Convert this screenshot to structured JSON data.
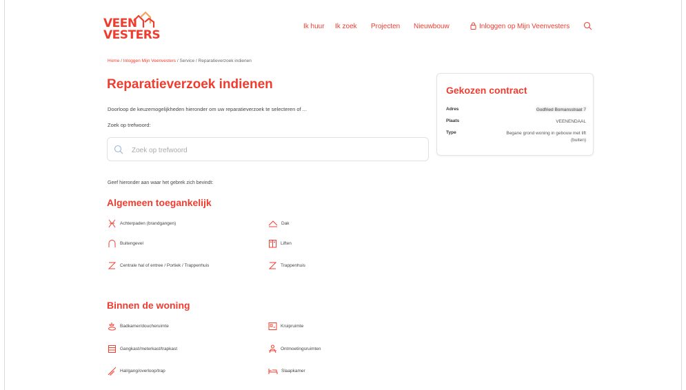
{
  "brand": {
    "logo_line1": "VEEN",
    "logo_line2": "VESTERS",
    "accent": "#f03c2f"
  },
  "nav": {
    "items": [
      "Ik huur",
      "Ik zoek",
      "Projecten",
      "Nieuwbouw"
    ],
    "login": "Inloggen op Mijn Veenvesters",
    "icons": {
      "login": "lock-icon",
      "search": "search-icon"
    }
  },
  "breadcrumb": {
    "home": "Home",
    "sep1": " / ",
    "login": "Inloggen Mijn Veenvesters",
    "sep2": " / ",
    "service": "Service",
    "sep3": " / ",
    "current": "Reparatieverzoek indienen"
  },
  "page": {
    "title": "Reparatieverzoek indienen",
    "intro": "Doorloop de keuzemogelijkheden hieronder om uw reparatieverzoek te selecteren of ...",
    "search_label": "Zoek op trefwoord:",
    "search_placeholder": "Zoek op trefwoord",
    "search_value": "",
    "location_question": "Geef hieronder aan waar het gebrek zich bevindt:"
  },
  "sections": [
    {
      "title": "Algemeen toegankelijk",
      "items": [
        {
          "label": "Achterpaden (brandgangen)",
          "icon": "path-icon"
        },
        {
          "label": "Dak",
          "icon": "roof-icon"
        },
        {
          "label": "Buitengevel",
          "icon": "facade-icon"
        },
        {
          "label": "Liften",
          "icon": "elevator-icon"
        },
        {
          "label": "Centrale hal of entree / Portiek / Trappenhuis",
          "icon": "stairs-icon"
        },
        {
          "label": "Trappenhuis",
          "icon": "stairs-icon"
        }
      ]
    },
    {
      "title": "Binnen de woning",
      "items": [
        {
          "label": "Badkamer/doucheruimte",
          "icon": "shower-icon"
        },
        {
          "label": "Kruipruimte",
          "icon": "crawlspace-icon"
        },
        {
          "label": "Gangkast/meterkast/trapkast",
          "icon": "cabinet-icon"
        },
        {
          "label": "Ontmoetingsruimten",
          "icon": "meeting-icon"
        },
        {
          "label": "Hal/gang/overloop/trap",
          "icon": "hallway-stairs-icon"
        },
        {
          "label": "Slaapkamer",
          "icon": "bed-icon"
        }
      ]
    }
  ],
  "contract": {
    "title": "Gekozen contract",
    "rows": [
      {
        "key": "Adres",
        "value": "Godfried Bomansstraat 7"
      },
      {
        "key": "Plaats",
        "value": "VEENENDAAL"
      },
      {
        "key": "Type",
        "value": "Begane grond woning in gebouw met lift (buiten)"
      }
    ]
  }
}
